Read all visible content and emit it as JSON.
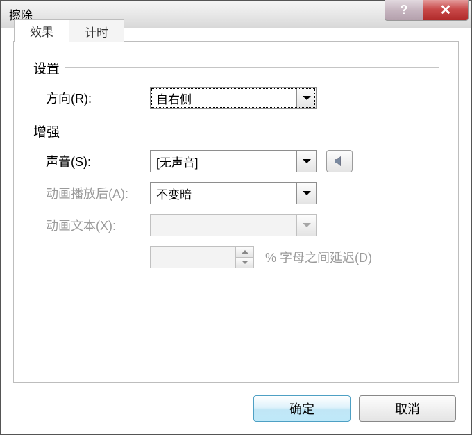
{
  "window": {
    "title": "擦除"
  },
  "tabs": {
    "effect": "效果",
    "timing": "计时"
  },
  "groups": {
    "settings_header": "设置",
    "enhance_header": "增强"
  },
  "settings": {
    "direction_label_pre": "方向(",
    "direction_label_key": "R",
    "direction_label_post": "):",
    "direction_value": "自右侧"
  },
  "enhance": {
    "sound_label_pre": "声音(",
    "sound_label_key": "S",
    "sound_label_post": "):",
    "sound_value": "[无声音]",
    "after_label_pre": "动画播放后(",
    "after_label_key": "A",
    "after_label_post": "):",
    "after_value": "不变暗",
    "text_label_pre": "动画文本(",
    "text_label_key": "X",
    "text_label_post": "):",
    "text_value": "",
    "delay_label_pre": "% 字母之间延迟(",
    "delay_label_key": "D",
    "delay_label_post": ")"
  },
  "buttons": {
    "ok": "确定",
    "cancel": "取消"
  }
}
